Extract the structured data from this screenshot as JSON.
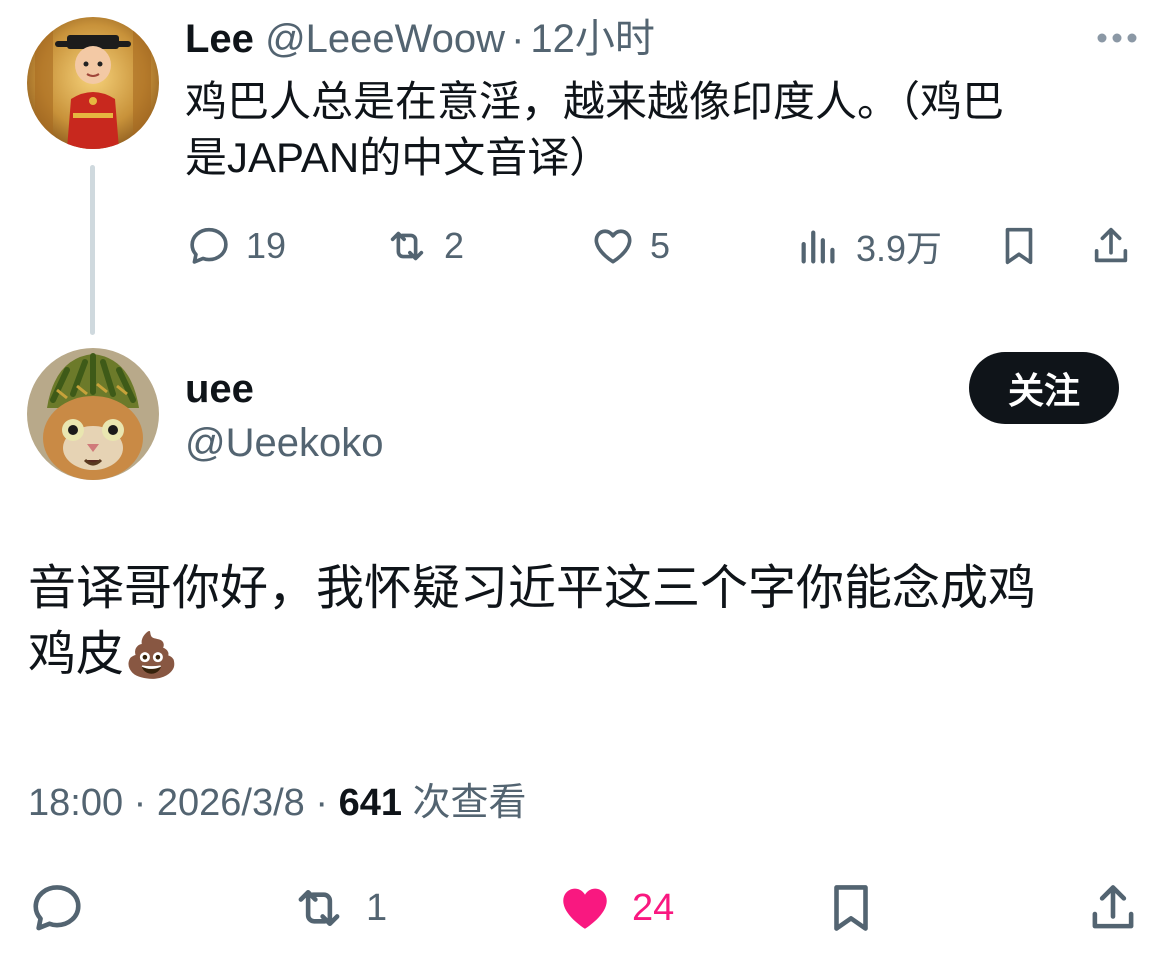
{
  "parent_tweet": {
    "author_name": "Lee",
    "author_handle": "@LeeeWoow",
    "separator": "·",
    "time": "12小时",
    "text_line1": "鸡巴人总是在意淫，越来越像印度人。（鸡巴",
    "text_line2": "是JAPAN的中文音译）",
    "replies": "19",
    "reposts": "2",
    "likes": "5",
    "views": "3.9万",
    "icons": [
      "more-icon",
      "reply-icon",
      "repost-icon",
      "like-icon",
      "views-icon",
      "bookmark-icon",
      "share-icon"
    ]
  },
  "main_tweet": {
    "author_name": "uee",
    "author_handle": "@Ueekoko",
    "follow_label": "关注",
    "text_line1": "音译哥你好，我怀疑习近平这三个字你能念成鸡",
    "text_line2": "鸡皮",
    "emoji": "💩",
    "meta_time": "18:00",
    "meta_sep1": "·",
    "meta_date": "2026/3/8",
    "meta_sep2": "·",
    "views_count": "641",
    "views_label": "次查看",
    "reposts": "1",
    "likes": "24",
    "like_color": "#f91880",
    "icons": [
      "reply-icon",
      "repost-icon",
      "heart-filled-icon",
      "bookmark-icon",
      "share-icon"
    ]
  }
}
